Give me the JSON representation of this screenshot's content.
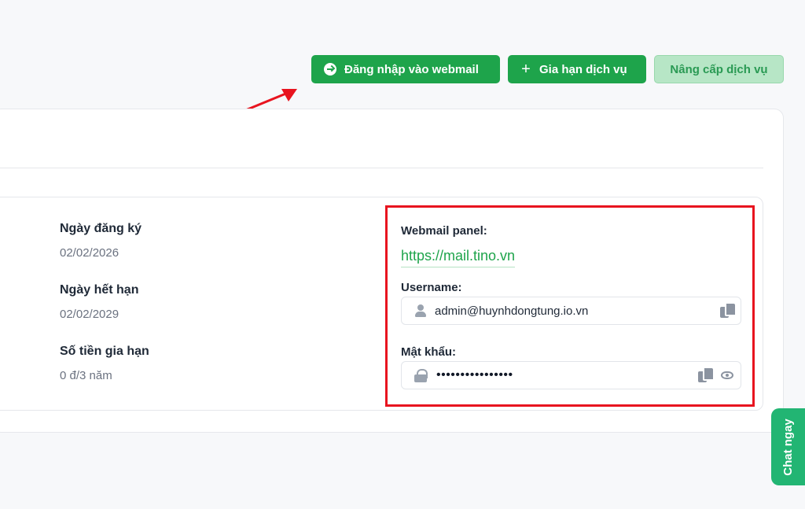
{
  "actions": {
    "login_webmail": "Đăng nhập vào webmail",
    "renew_service": "Gia hạn dịch vụ",
    "upgrade_service": "Nâng cấp dịch vụ"
  },
  "info": {
    "registered_label": "Ngày đăng ký",
    "registered_value": "02/02/2026",
    "expiry_label": "Ngày hết hạn",
    "expiry_value": "02/02/2029",
    "renew_amount_label": "Số tiền gia hạn",
    "renew_amount_value": "0 đ/3 năm"
  },
  "credentials": {
    "panel_label": "Webmail panel:",
    "panel_url": "https://mail.tino.vn",
    "username_label": "Username:",
    "username_value": "admin@huynhdongtung.io.vn",
    "password_label": "Mật khẩu:",
    "password_value": "••••••••••••••••"
  },
  "chat": {
    "label": "Chat ngay"
  },
  "colors": {
    "primary": "#1ea44b",
    "highlight": "#e8141f",
    "chat": "#22b573"
  }
}
